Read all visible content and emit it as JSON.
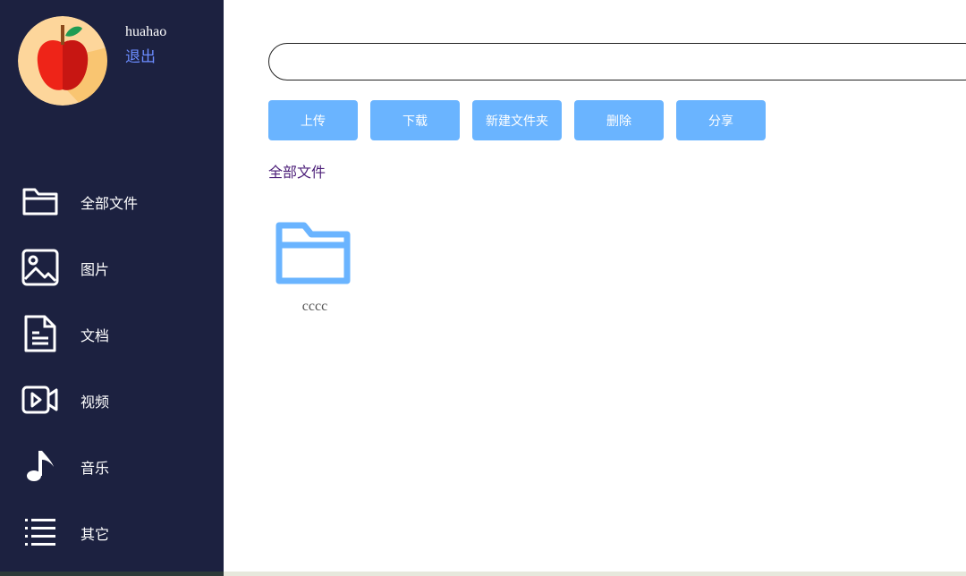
{
  "user": {
    "name": "huahao",
    "logout_label": "退出",
    "avatar_icon": "apple-avatar"
  },
  "sidebar": {
    "items": [
      {
        "label": "全部文件",
        "icon": "folder-icon"
      },
      {
        "label": "图片",
        "icon": "image-icon"
      },
      {
        "label": "文档",
        "icon": "document-icon"
      },
      {
        "label": "视频",
        "icon": "video-icon"
      },
      {
        "label": "音乐",
        "icon": "music-icon"
      },
      {
        "label": "其它",
        "icon": "list-icon"
      }
    ]
  },
  "search": {
    "value": "",
    "placeholder": ""
  },
  "toolbar": {
    "upload_label": "上传",
    "download_label": "下载",
    "new_folder_label": "新建文件夹",
    "delete_label": "删除",
    "share_label": "分享"
  },
  "breadcrumb": {
    "label": "全部文件"
  },
  "files": [
    {
      "name": "cccc",
      "type": "folder"
    }
  ],
  "colors": {
    "sidebar_bg": "#1c2140",
    "button_bg": "#6ab4ff",
    "folder_icon": "#6ab4ff",
    "logout_link": "#6b8cff",
    "breadcrumb": "#4b1d78"
  }
}
